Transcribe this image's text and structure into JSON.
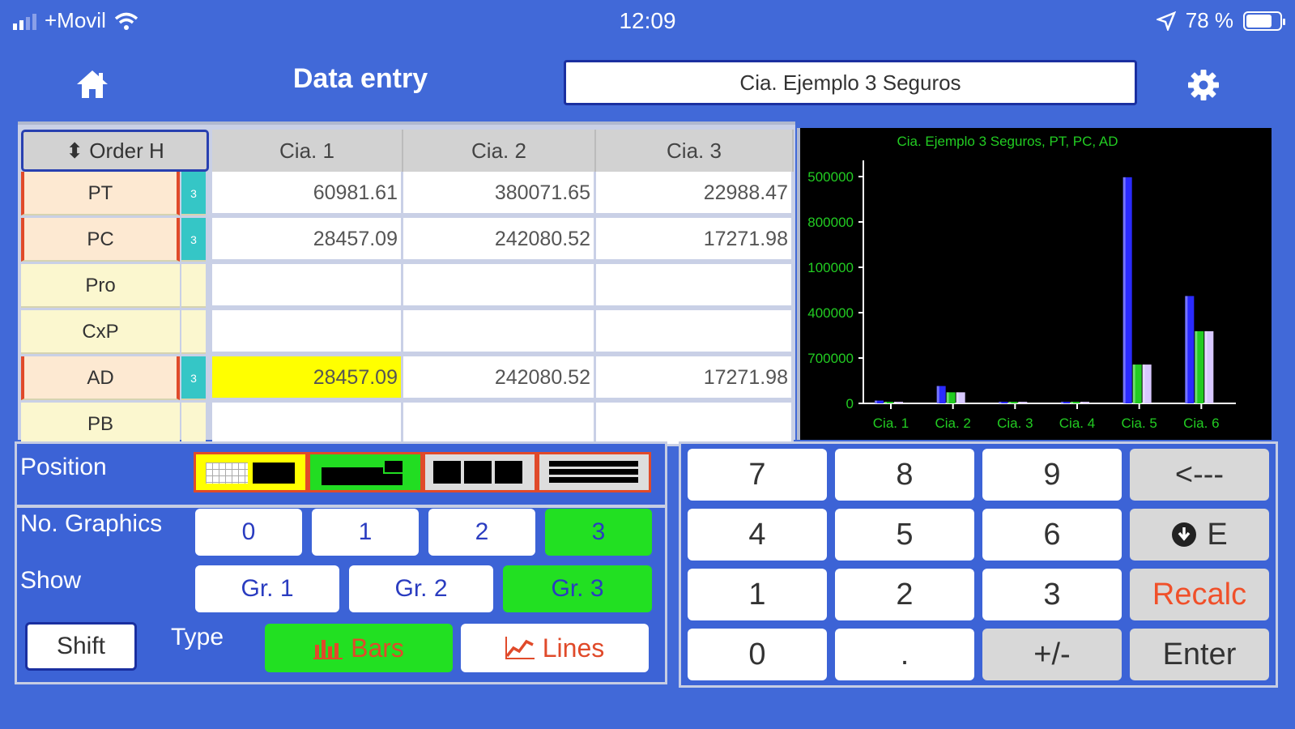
{
  "status_bar": {
    "carrier": "+Movil",
    "time": "12:09",
    "battery": "78 %"
  },
  "nav": {
    "title": "Data entry",
    "company": "Cia. Ejemplo 3 Seguros"
  },
  "table": {
    "order_button": "Order H",
    "columns": [
      "Cia. 1",
      "Cia. 2",
      "Cia. 3"
    ],
    "rows": [
      {
        "label": "PT",
        "flag": "3",
        "values": [
          "60981.61",
          "380071.65",
          "22988.47"
        ]
      },
      {
        "label": "PC",
        "flag": "3",
        "values": [
          "28457.09",
          "242080.52",
          "17271.98"
        ]
      },
      {
        "label": "Pro",
        "flag": "",
        "values": [
          "",
          "",
          ""
        ]
      },
      {
        "label": "CxP",
        "flag": "",
        "values": [
          "",
          "",
          ""
        ]
      },
      {
        "label": "AD",
        "flag": "3",
        "values": [
          "28457.09",
          "242080.52",
          "17271.98"
        ]
      },
      {
        "label": "PB",
        "flag": "",
        "values": [
          "",
          "",
          ""
        ]
      }
    ]
  },
  "chart_data": {
    "type": "bar",
    "title": "Cia. Ejemplo 3 Seguros, PT, PC, AD",
    "categories": [
      "Cia. 1",
      "Cia. 2",
      "Cia. 3",
      "Cia. 4",
      "Cia. 5",
      "Cia. 6"
    ],
    "y_tick_labels": [
      "0",
      "700000",
      "400000",
      "100000",
      "800000",
      "500000"
    ],
    "ylim": [
      0,
      5000000
    ],
    "series": [
      {
        "color": "#2a2aff",
        "values": [
          60981.61,
          380071.65,
          22988.47,
          15000,
          4950000,
          2350000
        ]
      },
      {
        "color": "#22cc22",
        "values": [
          28457.09,
          242080.52,
          17271.98,
          9000,
          850000,
          1580000
        ]
      },
      {
        "color": "#d8c8ff",
        "values": [
          28457.09,
          242080.52,
          17271.98,
          9000,
          850000,
          1580000
        ]
      }
    ],
    "legend": "none"
  },
  "controls": {
    "position_label": "Position",
    "graphics_label": "No. Graphics",
    "graphics_options": [
      "0",
      "1",
      "2",
      "3"
    ],
    "graphics_selected": "3",
    "show_label": "Show",
    "show_options": [
      "Gr. 1",
      "Gr. 2",
      "Gr. 3"
    ],
    "show_selected": "Gr. 3",
    "shift": "Shift",
    "type_label": "Type",
    "bars": "Bars",
    "lines": "Lines"
  },
  "keypad": {
    "keys": [
      "7",
      "8",
      "9",
      "<---",
      "4",
      "5",
      "6",
      "E",
      "1",
      "2",
      "3",
      "Recalc",
      "0",
      ".",
      "+/-",
      "Enter"
    ]
  },
  "colors": {
    "background": "#4169d8",
    "selected_green": "#22e022",
    "highlight_yellow": "#ffff00",
    "accent_red": "#e04a2a"
  }
}
